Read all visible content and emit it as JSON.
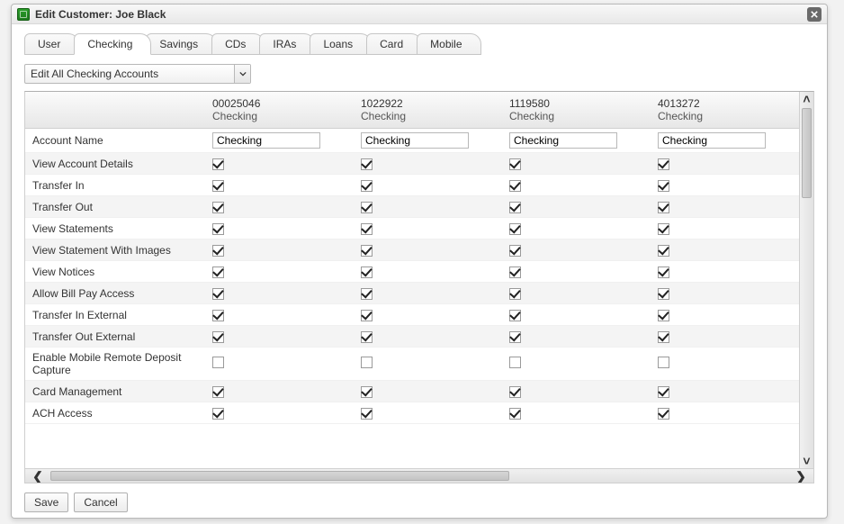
{
  "window": {
    "title": "Edit Customer: Joe Black"
  },
  "tabs": [
    {
      "label": "User",
      "active": false
    },
    {
      "label": "Checking",
      "active": true
    },
    {
      "label": "Savings",
      "active": false
    },
    {
      "label": "CDs",
      "active": false
    },
    {
      "label": "IRAs",
      "active": false
    },
    {
      "label": "Loans",
      "active": false
    },
    {
      "label": "Card",
      "active": false
    },
    {
      "label": "Mobile",
      "active": false
    }
  ],
  "dropdown": {
    "selected": "Edit All Checking Accounts"
  },
  "columns": [
    {
      "num": "00025046",
      "type": "Checking"
    },
    {
      "num": "1022922",
      "type": "Checking"
    },
    {
      "num": "1119580",
      "type": "Checking"
    },
    {
      "num": "4013272",
      "type": "Checking"
    }
  ],
  "rows": [
    {
      "label": "Account Name",
      "kind": "text",
      "values": [
        "Checking",
        "Checking",
        "Checking",
        "Checking"
      ]
    },
    {
      "label": "View Account Details",
      "kind": "check",
      "values": [
        true,
        true,
        true,
        true
      ]
    },
    {
      "label": "Transfer In",
      "kind": "check",
      "values": [
        true,
        true,
        true,
        true
      ]
    },
    {
      "label": "Transfer Out",
      "kind": "check",
      "values": [
        true,
        true,
        true,
        true
      ]
    },
    {
      "label": "View Statements",
      "kind": "check",
      "values": [
        true,
        true,
        true,
        true
      ]
    },
    {
      "label": "View Statement With Images",
      "kind": "check",
      "values": [
        true,
        true,
        true,
        true
      ]
    },
    {
      "label": "View Notices",
      "kind": "check",
      "values": [
        true,
        true,
        true,
        true
      ]
    },
    {
      "label": "Allow Bill Pay Access",
      "kind": "check",
      "values": [
        true,
        true,
        true,
        true
      ]
    },
    {
      "label": "Transfer In External",
      "kind": "check",
      "values": [
        true,
        true,
        true,
        true
      ]
    },
    {
      "label": "Transfer Out External",
      "kind": "check",
      "values": [
        true,
        true,
        true,
        true
      ]
    },
    {
      "label": "Enable Mobile Remote Deposit Capture",
      "kind": "check",
      "values": [
        false,
        false,
        false,
        false
      ]
    },
    {
      "label": "Card Management",
      "kind": "check",
      "values": [
        true,
        true,
        true,
        true
      ]
    },
    {
      "label": "ACH Access",
      "kind": "check",
      "values": [
        true,
        true,
        true,
        true
      ]
    }
  ],
  "buttons": {
    "save": "Save",
    "cancel": "Cancel"
  }
}
